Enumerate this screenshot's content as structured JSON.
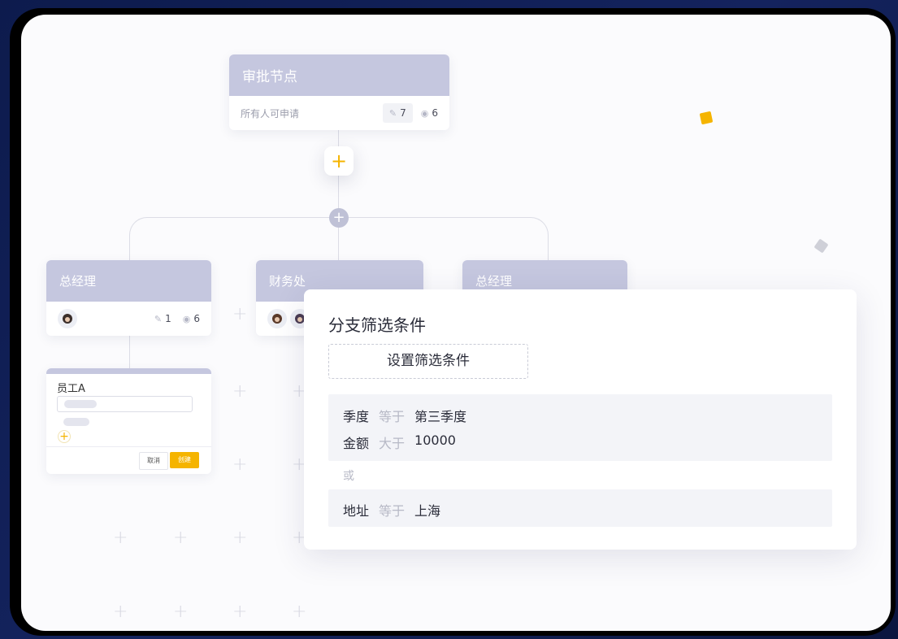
{
  "approval_node": {
    "title": "审批节点",
    "subtitle": "所有人可申请",
    "edit_count": "7",
    "view_count": "6"
  },
  "branches": [
    {
      "title": "总经理",
      "edit_count": "1",
      "view_count": "6"
    },
    {
      "title": "财务处"
    },
    {
      "title": "总经理"
    }
  ],
  "mini_form": {
    "field_label": "员工A",
    "cancel_label": "取消",
    "create_label": "创建"
  },
  "filter_panel": {
    "title": "分支筛选条件",
    "set_button": "设置筛选条件",
    "group1": [
      {
        "field": "季度",
        "op": "等于",
        "value": "第三季度"
      },
      {
        "field": "金额",
        "op": "大于",
        "value": "10000"
      }
    ],
    "or_label": "或",
    "group2": [
      {
        "field": "地址",
        "op": "等于",
        "value": "上海"
      }
    ]
  },
  "colors": {
    "node_header": "#c5c7df",
    "accent": "#f5b400"
  }
}
